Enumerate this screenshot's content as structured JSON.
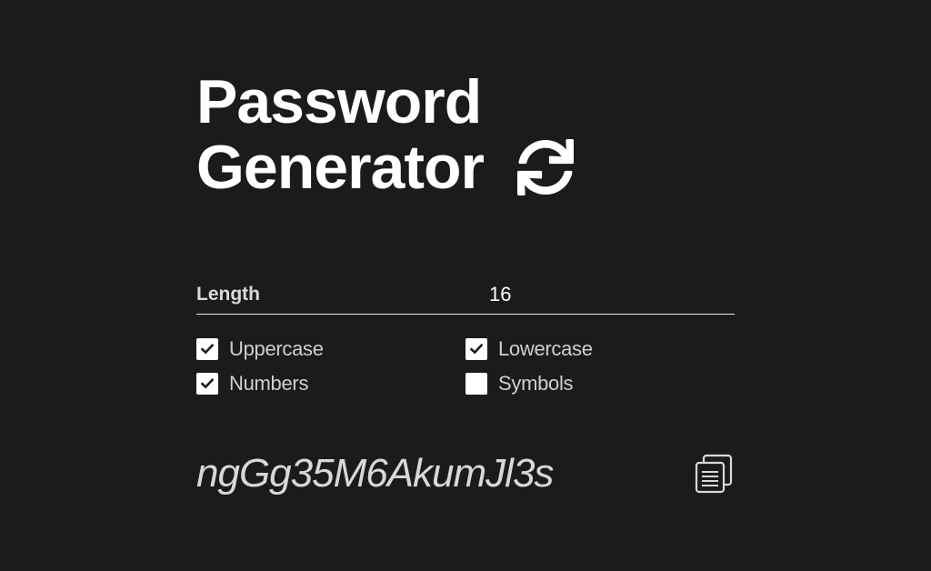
{
  "header": {
    "title_line1": "Password",
    "title_line2": "Generator",
    "refresh_icon": "refresh-icon"
  },
  "length": {
    "label": "Length",
    "value": "16"
  },
  "options": [
    {
      "label": "Uppercase",
      "checked": true
    },
    {
      "label": "Lowercase",
      "checked": true
    },
    {
      "label": "Numbers",
      "checked": true
    },
    {
      "label": "Symbols",
      "checked": false
    }
  ],
  "result": {
    "password": "ngGg35M6AkumJl3s",
    "copy_icon": "copy-icon"
  },
  "colors": {
    "background": "#1a1b1d",
    "text": "#ffffff",
    "muted_text": "#cfcfcf"
  }
}
